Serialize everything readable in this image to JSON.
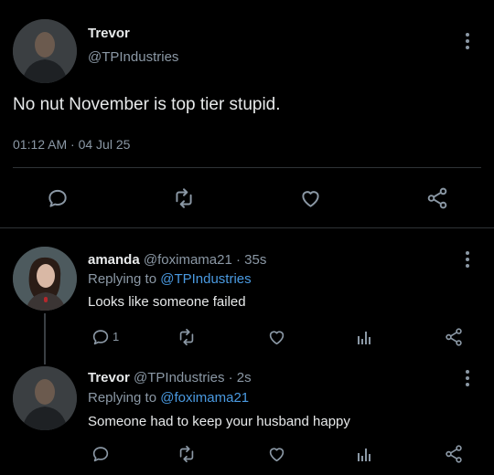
{
  "main_tweet": {
    "name": "Trevor",
    "handle": "@TPIndustries",
    "text": "No nut November is top tier stupid.",
    "timestamp": "01:12 AM · 04 Jul 25"
  },
  "replies": [
    {
      "name": "amanda",
      "meta": "@foximama21 · 35s",
      "replying_prefix": "Replying to",
      "replying_handle": "@TPIndustries",
      "text": "Looks like someone failed",
      "reply_count": "1"
    },
    {
      "name": "Trevor",
      "meta": "@TPIndustries · 2s",
      "replying_prefix": "Replying to",
      "replying_handle": "@foximama21",
      "text": "Someone had to keep your husband happy"
    }
  ],
  "icons": {
    "reply": "speech-bubble-icon",
    "retweet": "retweet-icon",
    "like": "heart-icon",
    "share": "share-icon",
    "analytics": "bar-chart-icon",
    "more": "vertical-dots-icon"
  },
  "colors": {
    "background": "#000000",
    "text": "#e7e9ea",
    "muted": "#8b98a5",
    "link": "#4a9ae1",
    "divider": "#2f3336"
  }
}
